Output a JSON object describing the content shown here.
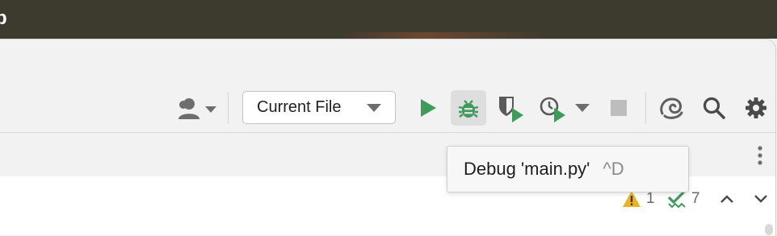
{
  "menubar": {
    "title": "p"
  },
  "toolbar": {
    "run_config": {
      "label": "Current File"
    },
    "tooltip": {
      "text": "Debug 'main.py'",
      "shortcut": "^D"
    },
    "icons": [
      "user-account-icon",
      "run-icon",
      "debug-icon",
      "coverage-icon",
      "profile-icon",
      "stop-icon",
      "ai-assistant-icon",
      "search-icon",
      "settings-icon"
    ]
  },
  "inspections": {
    "warnings": "1",
    "checks": "7"
  },
  "colors": {
    "run_green": "#3f9a5b",
    "warning_yellow": "#e8b22a",
    "icon_gray": "#6e6e6e"
  }
}
